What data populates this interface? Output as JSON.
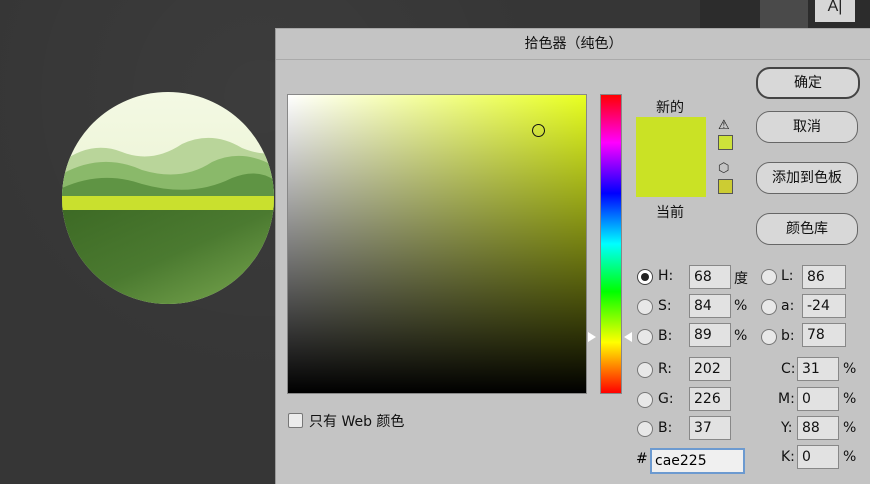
{
  "dialog": {
    "title": "拾色器（纯色）",
    "new_label": "新的",
    "current_label": "当前",
    "new_color": "#cae225",
    "current_color": "#cae225",
    "buttons": {
      "ok": "确定",
      "cancel": "取消",
      "add_swatch": "添加到色板",
      "libraries": "颜色库"
    },
    "web_only_label": "只有 Web 颜色",
    "hsb": {
      "h": {
        "label": "H:",
        "value": "68",
        "unit": "度"
      },
      "s": {
        "label": "S:",
        "value": "84",
        "unit": "%"
      },
      "b": {
        "label": "B:",
        "value": "89",
        "unit": "%"
      }
    },
    "lab": {
      "l": {
        "label": "L:",
        "value": "86"
      },
      "a": {
        "label": "a:",
        "value": "-24"
      },
      "b": {
        "label": "b:",
        "value": "78"
      }
    },
    "rgb": {
      "r": {
        "label": "R:",
        "value": "202"
      },
      "g": {
        "label": "G:",
        "value": "226"
      },
      "b": {
        "label": "B:",
        "value": "37"
      }
    },
    "cmyk": {
      "c": {
        "label": "C:",
        "value": "31",
        "unit": "%"
      },
      "m": {
        "label": "M:",
        "value": "0",
        "unit": "%"
      },
      "y": {
        "label": "Y:",
        "value": "88",
        "unit": "%"
      },
      "k": {
        "label": "K:",
        "value": "0",
        "unit": "%"
      }
    },
    "hex": {
      "label": "#",
      "value": "cae225"
    }
  },
  "toolbar": {
    "char_tool": "A|"
  },
  "watermark": {
    "logo": "",
    "text": ""
  },
  "icons": {
    "gamut_warning": "warning-triangle-icon",
    "web_safe": "cube-icon"
  }
}
